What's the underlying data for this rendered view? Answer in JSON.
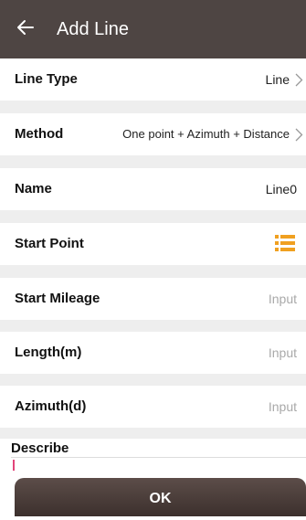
{
  "header": {
    "title": "Add Line",
    "back_icon": "arrow-left-icon",
    "background": "#4e4543"
  },
  "form": {
    "line_type": {
      "label": "Line Type",
      "value": "Line"
    },
    "method": {
      "label": "Method",
      "value": "One point + Azimuth + Distance"
    },
    "name": {
      "label": "Name",
      "value": "Line0"
    },
    "start_point": {
      "label": "Start Point",
      "icon": "list-icon",
      "icon_color": "#f0a020"
    },
    "start_mileage": {
      "label": "Start Mileage",
      "placeholder": "Input"
    },
    "length": {
      "label": "Length(m)",
      "placeholder": "Input"
    },
    "azimuth": {
      "label": "Azimuth(d)",
      "placeholder": "Input"
    },
    "describe": {
      "label": "Describe",
      "value": ""
    }
  },
  "footer": {
    "ok_label": "OK"
  },
  "colors": {
    "accent_orange": "#f0a020",
    "caret": "#e2457a",
    "separator": "#eeeeee"
  }
}
